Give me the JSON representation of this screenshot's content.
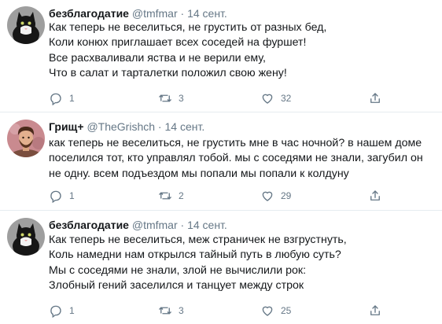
{
  "tweets": [
    {
      "name": "безблагодатие",
      "handle": "@tmfmar",
      "dot": "·",
      "date": "14 сент.",
      "text": "Как теперь не веселиться, не грустить от разных бед,\nКоли конюх приглашает всех соседей на фуршет!\nВсе расхваливали яства и не верили ему,\nЧто в салат и тарталетки положил свою жену!",
      "replies": "1",
      "retweets": "3",
      "likes": "32",
      "avatar": "cat-avatar"
    },
    {
      "name": "Грищ+",
      "handle": "@TheGrishch",
      "dot": "·",
      "date": "14 сент.",
      "text": "как теперь не веселиться, не грустить мне в час ночной? в нашем доме поселился тот, кто управлял тобой. мы с соседями не знали, загубил он не одну. всем подъездом мы попали мы попали к колдуну",
      "replies": "1",
      "retweets": "2",
      "likes": "29",
      "avatar": "portrait-avatar"
    },
    {
      "name": "безблагодатие",
      "handle": "@tmfmar",
      "dot": "·",
      "date": "14 сент.",
      "text": "Как теперь не веселиться, меж страничек не взгрустнуть,\nКоль намедни нам открылся тайный путь в любую суть?\nМы с соседями не знали, злой не вычислили рок:\nЗлобный гений заселился и танцует между строк",
      "replies": "1",
      "retweets": "3",
      "likes": "25",
      "avatar": "cat-avatar"
    }
  ],
  "colors": {
    "text": "#14171a",
    "muted": "#657786",
    "divider": "#e6ecf0"
  }
}
